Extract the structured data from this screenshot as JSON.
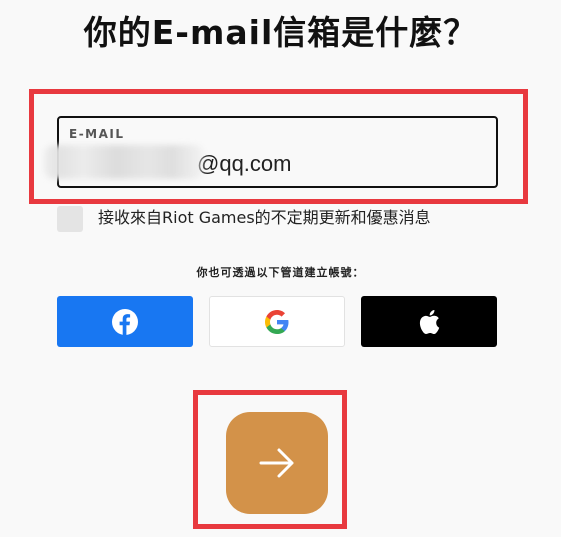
{
  "title": "你的E-mail信箱是什麼？",
  "email": {
    "label": "E-MAIL",
    "value": "@qq.com"
  },
  "newsletter": {
    "label": "接收來自Riot Games的不定期更新和優惠消息",
    "checked": false
  },
  "alternative_signup_text": "你也可透過以下管道建立帳號：",
  "social_buttons": [
    {
      "provider": "facebook",
      "icon": "facebook-icon",
      "color": "#1877f2"
    },
    {
      "provider": "google",
      "icon": "google-icon",
      "color": "#ffffff"
    },
    {
      "provider": "apple",
      "icon": "apple-icon",
      "color": "#000000"
    }
  ],
  "submit": {
    "icon": "arrow-right-icon",
    "color": "#d39249"
  },
  "colors": {
    "highlight": "#e8393f",
    "background": "#f9f9f9"
  }
}
